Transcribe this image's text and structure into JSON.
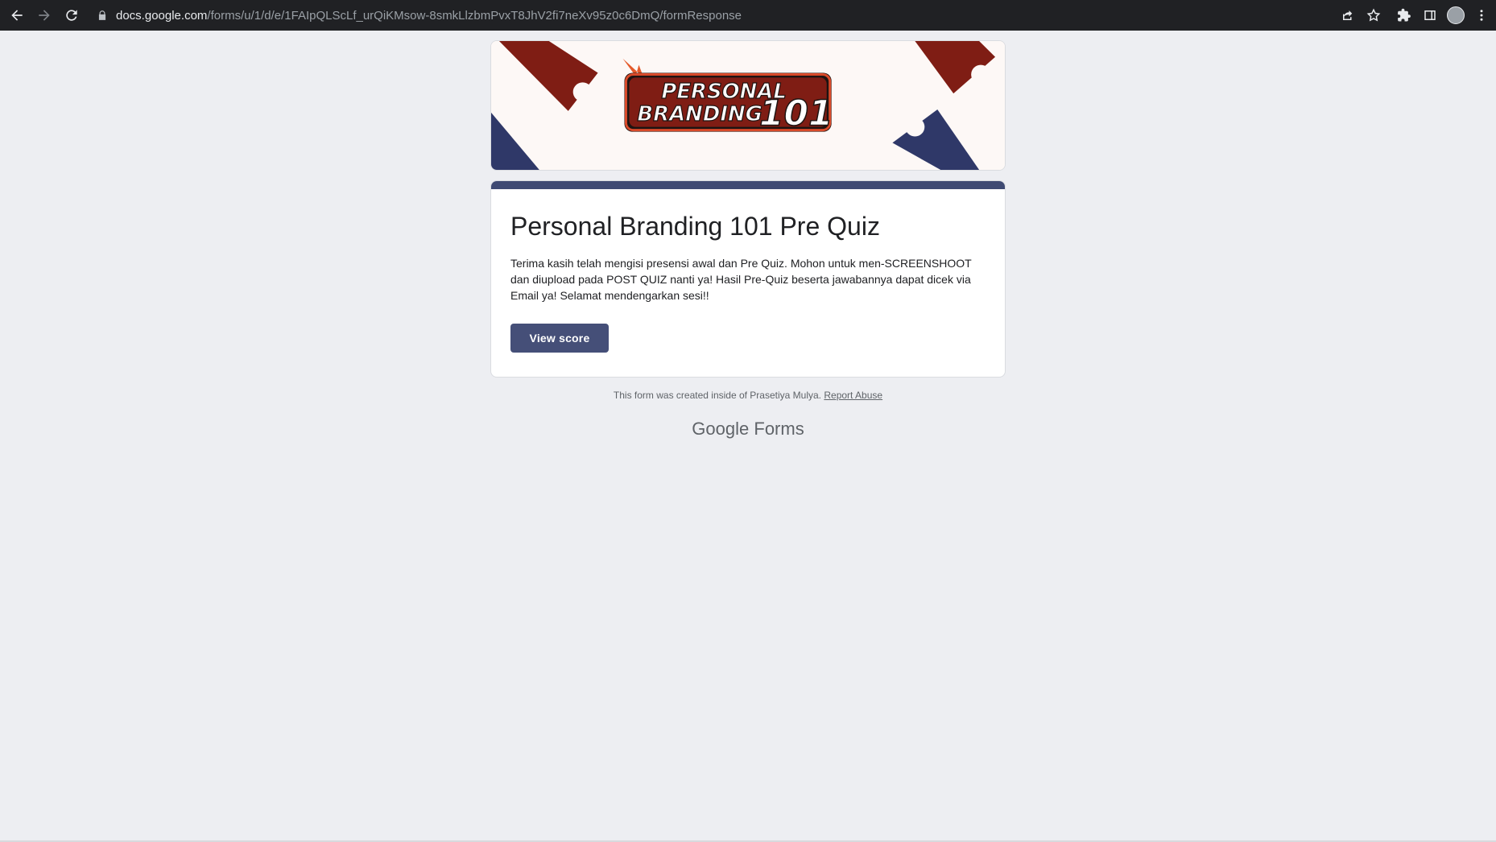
{
  "browser": {
    "url_host": "docs.google.com",
    "url_path": "/forms/u/1/d/e/1FAIpQLScLf_urQiKMsow-8smkLlzbmPvxT8JhV2fi7neXv95z0c6DmQ/formResponse"
  },
  "banner": {
    "line1": "PERSONAL",
    "line2": "BRANDING",
    "number": "101"
  },
  "form": {
    "title": "Personal Branding 101 Pre Quiz",
    "description": "Terima kasih telah mengisi presensi awal dan Pre Quiz. Mohon untuk men-SCREENSHOOT dan diupload pada POST QUIZ nanti ya! Hasil Pre-Quiz beserta jawabannya dapat dicek via Email ya! Selamat mendengarkan sesi!!",
    "view_score_label": "View score"
  },
  "footer": {
    "created_text": "This form was created inside of Prasetiya Mulya.",
    "report_label": "Report Abuse",
    "brand_google": "Google",
    "brand_forms": "Forms"
  },
  "colors": {
    "theme": "#3f4a73",
    "button": "#454f78",
    "page_bg": "#edeef2",
    "banner_red": "#7f1d14",
    "banner_navy": "#2f3868"
  },
  "icons": [
    "back-arrow-icon",
    "forward-arrow-icon",
    "reload-icon",
    "lock-icon",
    "share-icon",
    "star-icon",
    "extensions-icon",
    "side-panel-icon",
    "profile-avatar",
    "more-vert-icon"
  ]
}
